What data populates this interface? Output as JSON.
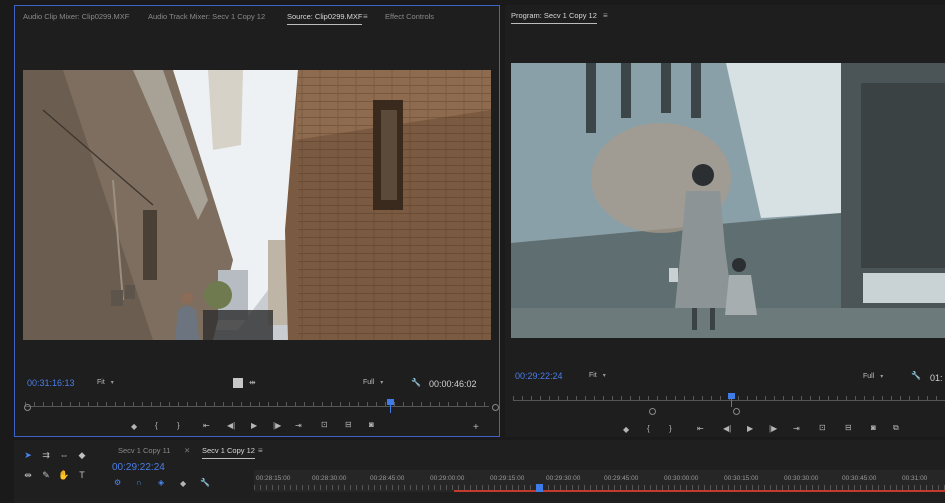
{
  "source_panel": {
    "tabs": [
      {
        "label": "Audio Clip Mixer: Clip0299.MXF"
      },
      {
        "label": "Audio Track Mixer: Secv 1 Copy 12"
      },
      {
        "label": "Source: Clip0299.MXF",
        "active": true
      },
      {
        "label": "Effect Controls"
      }
    ],
    "menu_icon": "≡",
    "timecode_current": "00:31:16:13",
    "zoom_select": "Fit",
    "resolution_select": "Full",
    "timecode_duration": "00:00:46:02"
  },
  "program_panel": {
    "title": "Program: Secv 1 Copy 12",
    "menu_icon": "≡",
    "timecode_current": "00:29:22:24",
    "zoom_select": "Fit",
    "resolution_select": "Full",
    "timecode_duration_partial": "01:"
  },
  "timeline_panel": {
    "tabs": [
      {
        "label": "Secv 1 Copy 11"
      },
      {
        "label": "Secv 1 Copy 12",
        "active": true
      }
    ],
    "menu_icon": "≡",
    "timecode": "00:29:22:24",
    "ruler_labels": [
      "00:28:15:00",
      "00:28:30:00",
      "00:28:45:00",
      "00:29:00:00",
      "00:29:15:00",
      "00:29:30:00",
      "00:29:45:00",
      "00:30:00:00",
      "00:30:15:00",
      "00:30:30:00",
      "00:30:45:00",
      "00:31:00"
    ]
  },
  "colors": {
    "accent": "#3f7ce8",
    "panel_border_active": "#3f64c8",
    "work_area": "#c23a2a"
  }
}
